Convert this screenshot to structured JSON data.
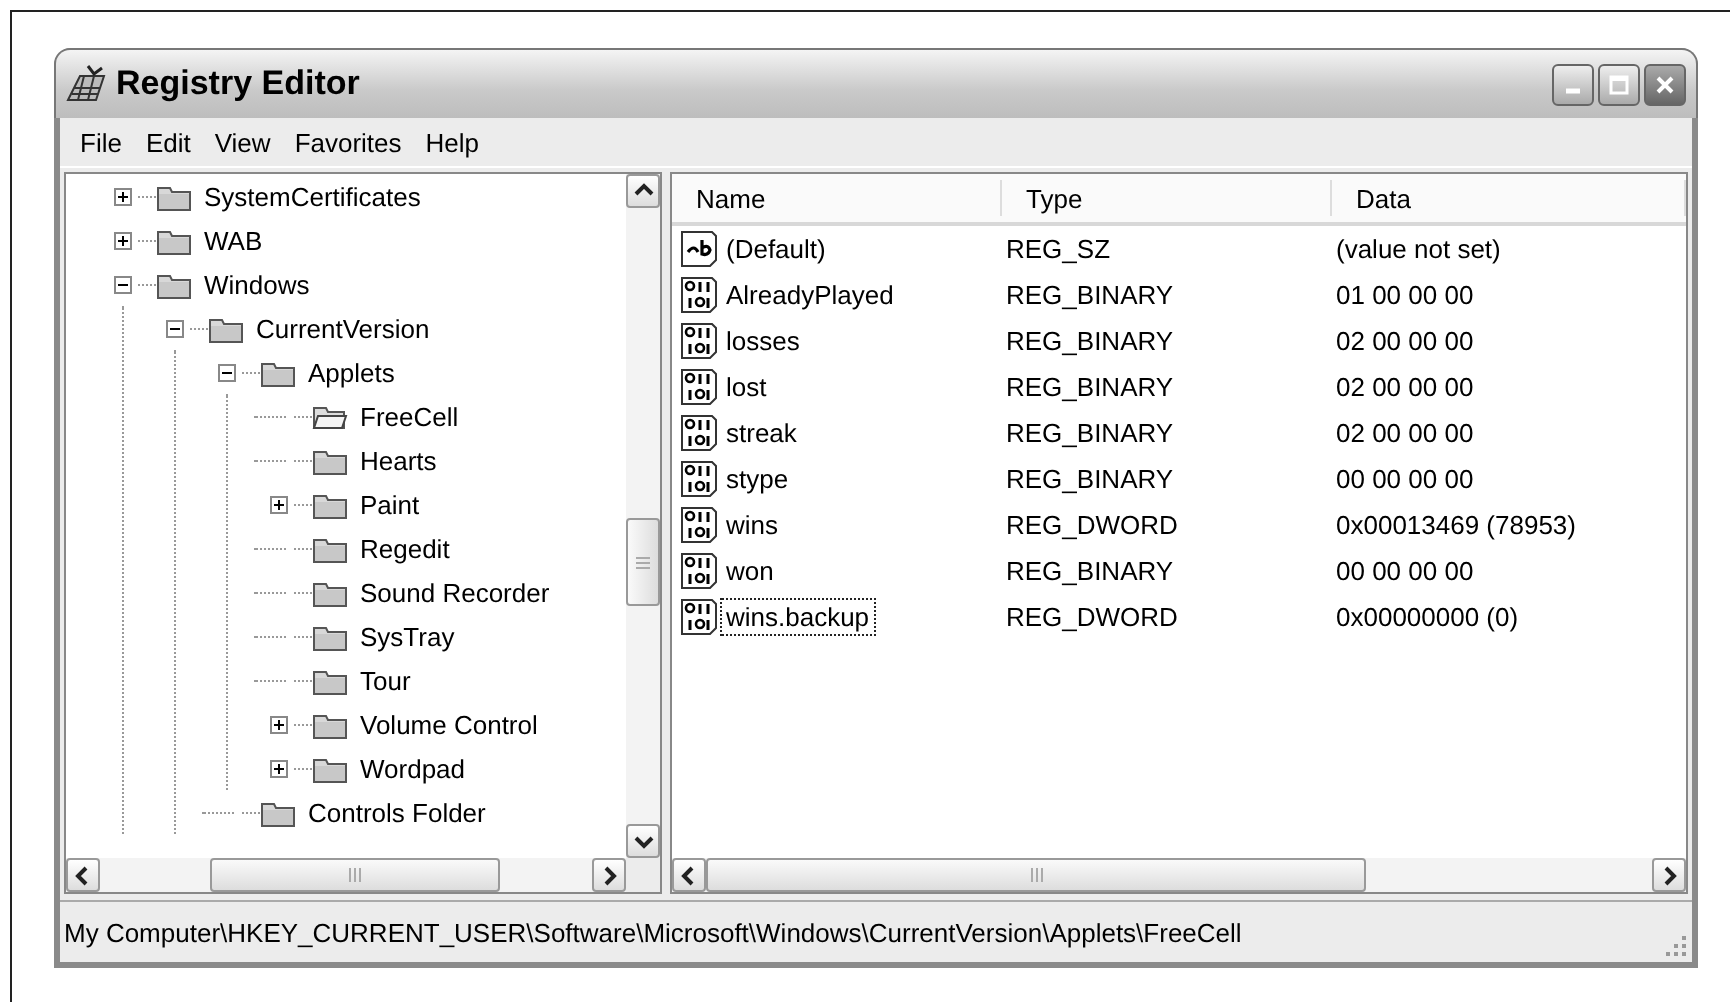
{
  "window": {
    "title": "Registry Editor"
  },
  "menu": [
    "File",
    "Edit",
    "View",
    "Favorites",
    "Help"
  ],
  "tree": [
    {
      "label": "SystemCertificates",
      "expanded": false,
      "selected": false
    },
    {
      "label": "WAB",
      "expanded": false,
      "selected": false
    },
    {
      "label": "Windows",
      "expanded": true,
      "selected": false,
      "children": [
        {
          "label": "CurrentVersion",
          "expanded": true,
          "selected": false,
          "children": [
            {
              "label": "Applets",
              "expanded": true,
              "selected": false,
              "children": [
                {
                  "label": "FreeCell",
                  "selected": true
                },
                {
                  "label": "Hearts",
                  "selected": false
                },
                {
                  "label": "Paint",
                  "expanded": false,
                  "selected": false
                },
                {
                  "label": "Regedit",
                  "selected": false
                },
                {
                  "label": "Sound Recorder",
                  "selected": false
                },
                {
                  "label": "SysTray",
                  "selected": false
                },
                {
                  "label": "Tour",
                  "selected": false
                },
                {
                  "label": "Volume Control",
                  "expanded": false,
                  "selected": false
                },
                {
                  "label": "Wordpad",
                  "expanded": false,
                  "selected": false
                }
              ]
            },
            {
              "label": "Controls Folder",
              "selected": false
            }
          ]
        }
      ]
    }
  ],
  "values": {
    "columns": [
      "Name",
      "Type",
      "Data"
    ],
    "rows": [
      {
        "kind": "string",
        "name": "(Default)",
        "type": "REG_SZ",
        "data": "(value not set)",
        "focused": false
      },
      {
        "kind": "binary",
        "name": "AlreadyPlayed",
        "type": "REG_BINARY",
        "data": "01 00 00 00",
        "focused": false
      },
      {
        "kind": "binary",
        "name": "losses",
        "type": "REG_BINARY",
        "data": "02 00 00 00",
        "focused": false
      },
      {
        "kind": "binary",
        "name": "lost",
        "type": "REG_BINARY",
        "data": "02 00 00 00",
        "focused": false
      },
      {
        "kind": "binary",
        "name": "streak",
        "type": "REG_BINARY",
        "data": "02 00 00 00",
        "focused": false
      },
      {
        "kind": "binary",
        "name": "stype",
        "type": "REG_BINARY",
        "data": "00 00 00 00",
        "focused": false
      },
      {
        "kind": "binary",
        "name": "wins",
        "type": "REG_DWORD",
        "data": "0x00013469 (78953)",
        "focused": false
      },
      {
        "kind": "binary",
        "name": "won",
        "type": "REG_BINARY",
        "data": "00 00 00 00",
        "focused": false
      },
      {
        "kind": "binary",
        "name": "wins.backup",
        "type": "REG_DWORD",
        "data": "0x00000000 (0)",
        "focused": true
      }
    ]
  },
  "status_bar": "My Computer\\HKEY_CURRENT_USER\\Software\\Microsoft\\Windows\\CurrentVersion\\Applets\\FreeCell"
}
